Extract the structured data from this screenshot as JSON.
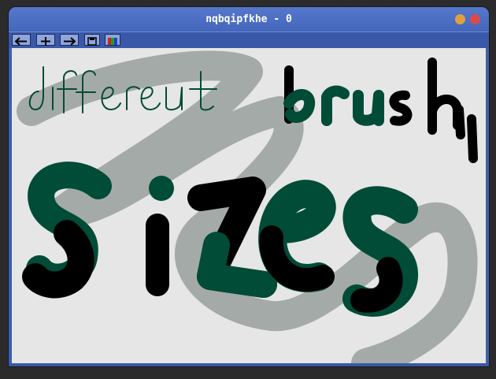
{
  "window": {
    "title": "nqbqipfkhe - 0",
    "close_color": "#d94b4b",
    "minimize_color": "#e0a040"
  },
  "toolbar": {
    "buttons": [
      {
        "icon": "arrow-left-icon"
      },
      {
        "icon": "plus-icon"
      },
      {
        "icon": "arrow-right-icon"
      },
      {
        "icon": "save-icon"
      },
      {
        "icon": "palette-icon"
      }
    ]
  },
  "canvas": {
    "colors": {
      "background": "#e6e6e6",
      "gray_stroke": "#a4aaa7",
      "green": "#004c37",
      "black": "#000000"
    },
    "strokes": [
      {
        "name": "small-brush-text",
        "text": "different"
      },
      {
        "name": "medium-brush-text",
        "text": "brush"
      },
      {
        "name": "large-brush-text",
        "text": "sizes"
      }
    ]
  }
}
